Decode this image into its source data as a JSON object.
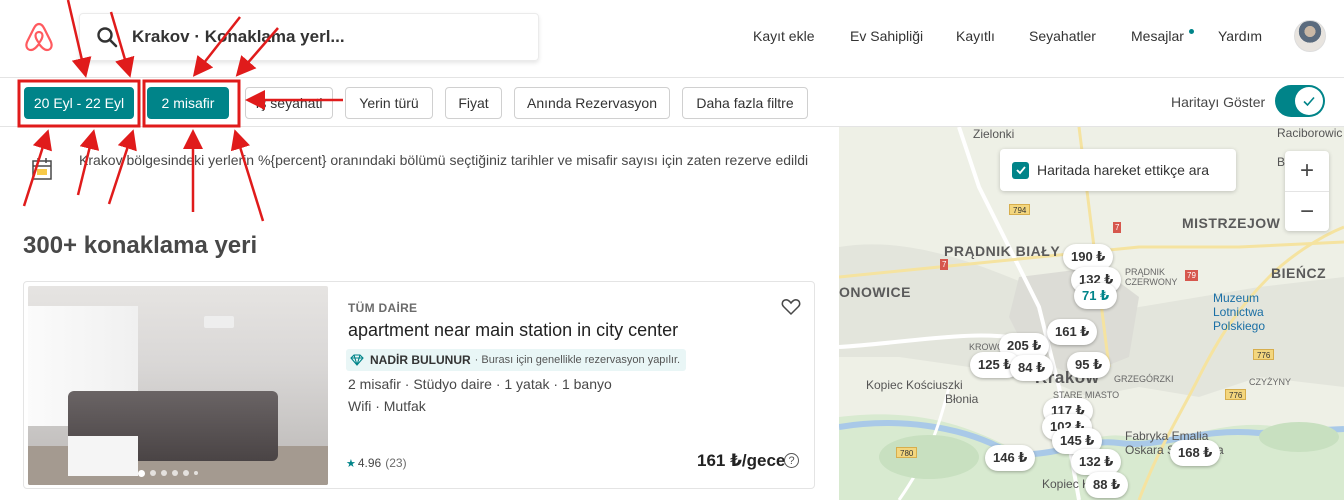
{
  "header": {
    "search_text": "Krakov · Konaklama yerl...",
    "nav": [
      "Kayıt ekle",
      "Ev Sahipliği",
      "Kayıtlı",
      "Seyahatler",
      "Mesajlar",
      "Yardım"
    ]
  },
  "filters": {
    "dates": "20 Eyl - 22 Eyl",
    "guests": "2 misafir",
    "work_trip": "İş seyahati",
    "place_type": "Yerin türü",
    "price": "Fiyat",
    "instant": "Anında Rezervasyon",
    "more": "Daha fazla filtre",
    "map_toggle_label": "Haritayı Göster",
    "map_toggle_on": true
  },
  "notice": "Krakov bölgesindeki yerlerin %{percent} oranındaki bölümü seçtiğiniz tarihler ve misafir sayısı için zaten rezerve edildi",
  "results_title": "300+ konaklama yeri",
  "listing": {
    "type": "TÜM DAİRE",
    "title": "apartment near main station in city center",
    "rare_title": "NADİR BULUNUR",
    "rare_sub": "· Burası için genellikle rezervasyon yapılır.",
    "amenities1": "2 misafir · Stüdyo daire · 1 yatak · 1 banyo",
    "amenities2": "Wifi · Mutfak",
    "rating": "4.96",
    "reviews": "(23)",
    "price": "161 ₺/gece",
    "info": "?"
  },
  "map": {
    "search_on_move": "Haritada hareket ettikçe ara",
    "zoom_in": "+",
    "zoom_out": "−",
    "places": {
      "zielonki": "Zielonki",
      "raciborowice": "Raciborowic",
      "batowice": "Batow",
      "mistrzejowice": "MISTRZEJOW",
      "pradnik_bialy": "PRĄDNIK BIAŁY",
      "pradnik_czerwony": "PRĄDNIK CZERWONY",
      "bronowice": "ONOWICE",
      "bienczyce": "BIEŃCZ",
      "krowodrza": "KROWODRZA",
      "grzegorzki": "GRZEGÓRZKI",
      "czyzyny": "CZYŻYNY",
      "krakow": "Krakow",
      "stare_miasto": "STARE MIASTO",
      "kopiec_kosciuszki": "Kopiec Kościuszki",
      "blonia": "Błonia",
      "kopiec_krakusa": "Kopiec Krakusa",
      "museum": "Muzeum Lotnictwa Polskiego",
      "fabryka": "Fabryka Emalia Oskara Schindlera"
    },
    "roads": [
      "794",
      "7",
      "7",
      "79",
      "776",
      "776",
      "780",
      "7"
    ],
    "pins": [
      "190 ₺",
      "132 ₺",
      "71 ₺",
      "161 ₺",
      "205 ₺",
      "125 ₺",
      "84 ₺",
      "95 ₺",
      "117 ₺",
      "102 ₺",
      "145 ₺",
      "146 ₺",
      "132 ₺",
      "168 ₺",
      "88 ₺"
    ],
    "active_pin": "71 ₺"
  },
  "colors": {
    "accent": "#008489",
    "brand": "#FF5A5F",
    "annotation": "#E01B1B"
  }
}
